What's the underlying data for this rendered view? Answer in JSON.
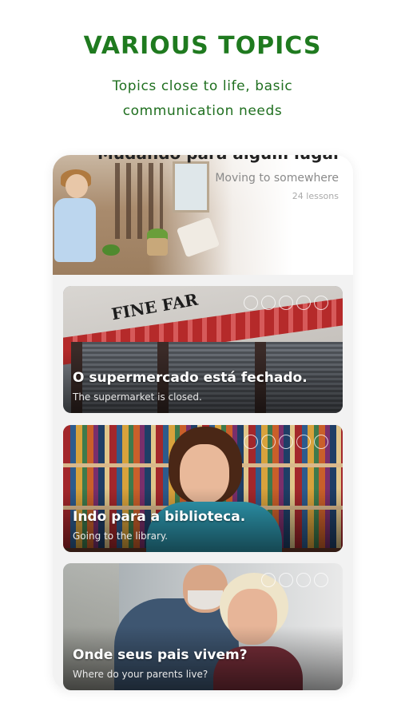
{
  "header": {
    "title": "VARIOUS TOPICS",
    "subtitle_line1": "Topics close to life, basic",
    "subtitle_line2": "communication needs"
  },
  "colors": {
    "accent_green": "#1f7a1f"
  },
  "top_card": {
    "title": "Mudando para algum lugar",
    "subtitle": "Moving to somewhere",
    "lessons": "24 lessons"
  },
  "topics": [
    {
      "title": "O supermercado está fechado.",
      "subtitle": "The supermarket is closed.",
      "sign_text": "FINE FAR"
    },
    {
      "title": "Indo para a biblioteca.",
      "subtitle": "Going to the library."
    },
    {
      "title": "Onde seus pais vivem?",
      "subtitle": "Where do your parents live?"
    }
  ]
}
